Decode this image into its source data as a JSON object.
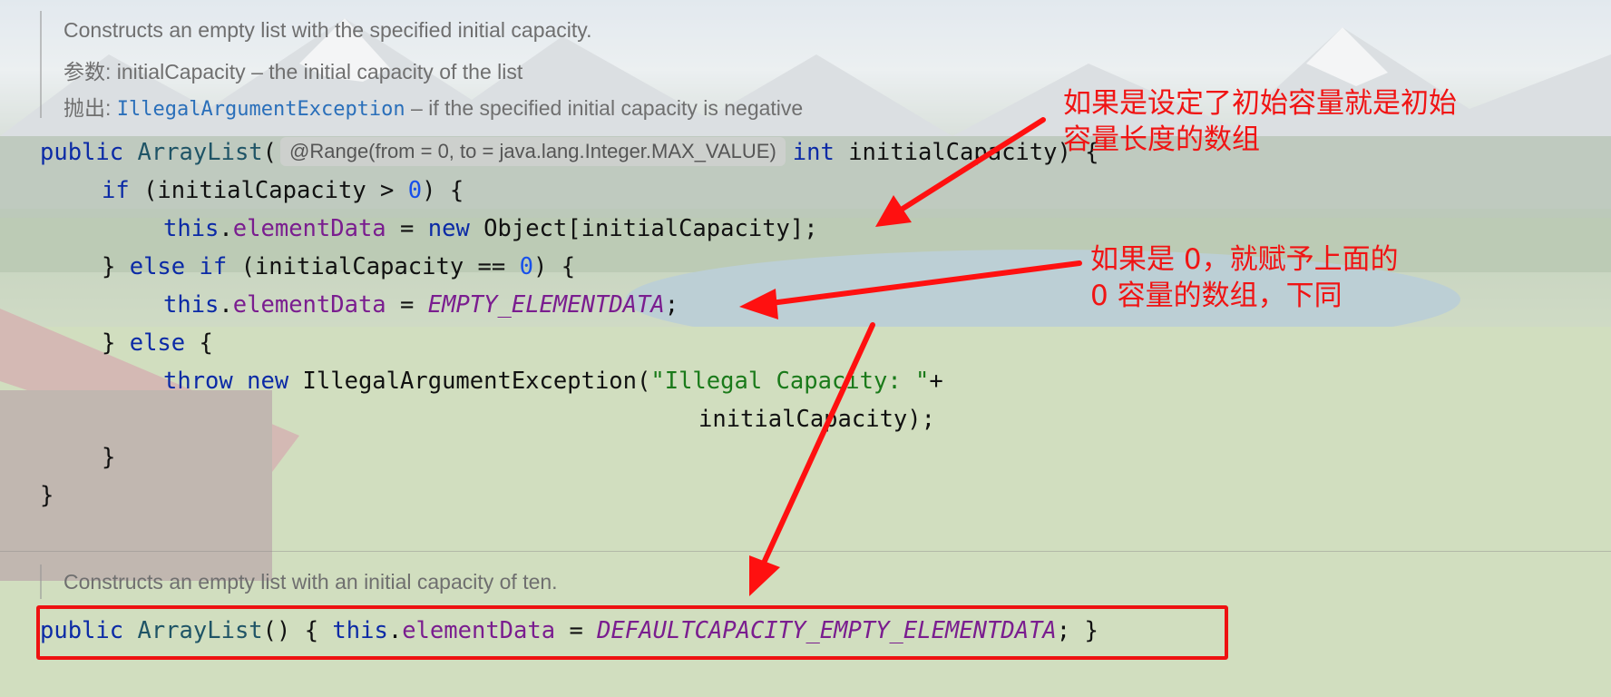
{
  "doc1": {
    "line1": "Constructs an empty list with the specified initial capacity.",
    "param_label": "参数:",
    "param_name": "initialCapacity",
    "param_desc": " – the initial capacity of the list",
    "throws_label": "抛出:",
    "throws_name": "IllegalArgumentException",
    "throws_desc": " – if the specified initial capacity is negative"
  },
  "code1": {
    "public": "public",
    "ctor": "ArrayList",
    "paren_open": "(",
    "annotation_hint": "@Range(from = 0, to = java.lang.Integer.MAX_VALUE)",
    "int": "int",
    "param_sig": " initialCapacity) {",
    "if": "if",
    "cond1_a": " (initialCapacity > ",
    "zero1": "0",
    "cond1_b": ") {",
    "this1": "this",
    "elementData1": "elementData",
    "assign1": " = ",
    "new1": "new",
    "obj_arr": " Object[initialCapacity];",
    "close_else_if": "} ",
    "else1": "else",
    "if2": "if",
    "cond2_a": " (initialCapacity == ",
    "zero2": "0",
    "cond2_b": ") {",
    "this2": "this",
    "elementData2": "elementData",
    "assign2": " = ",
    "empty_const": "EMPTY_ELEMENTDATA",
    "semi2": ";",
    "close_else": "} ",
    "else2": "else",
    "brace_open": " {",
    "throw": "throw",
    "new2": "new",
    "exception_call": " IllegalArgumentException(",
    "str_lit": "\"Illegal Capacity: \"",
    "plus": "+",
    "cont_line": "initialCapacity);",
    "close_inner": "}",
    "close_outer": "}"
  },
  "doc2": {
    "line1": "Constructs an empty list with an initial capacity of ten."
  },
  "code2": {
    "public": "public",
    "ctor": "ArrayList",
    "sig": "() { ",
    "this": "this",
    "dot": ".",
    "elementData": "elementData",
    "assign": " = ",
    "default_const": "DEFAULTCAPACITY_EMPTY_ELEMENTDATA",
    "end": "; }"
  },
  "annotations": {
    "note1_line1": "如果是设定了初始容量就是初始",
    "note1_line2": "容量长度的数组",
    "note2_line1": "如果是 0，就赋予上面的",
    "note2_line2": "0 容量的数组，下同",
    "color": "#f01414"
  }
}
